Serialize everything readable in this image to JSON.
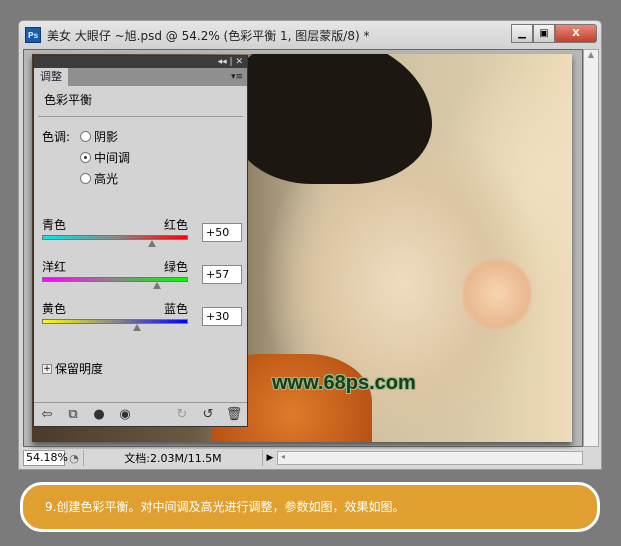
{
  "window": {
    "title": "美女 大眼仔 ~旭.psd @ 54.2% (色彩平衡 1, 图层蒙版/8) *",
    "app_icon": "Ps",
    "minimize": "▁",
    "maximize": "▣",
    "close": "X"
  },
  "canvas": {
    "watermark": "www.68ps.com"
  },
  "status": {
    "zoom": "54.18%",
    "doc_info": "文档:2.03M/11.5M",
    "arrow": "▶"
  },
  "panel": {
    "collapse": "◂◂ | ✕",
    "tab": "调整",
    "menu": "▾≡",
    "title": "色彩平衡",
    "tone_label": "色调:",
    "tones": [
      {
        "label": "阴影",
        "selected": false
      },
      {
        "label": "中间调",
        "selected": true
      },
      {
        "label": "高光",
        "selected": false
      }
    ],
    "sliders": [
      {
        "left": "青色",
        "right": "红色",
        "value": "+50",
        "num": 50,
        "colors": [
          "#00e8e8",
          "#ff0000"
        ]
      },
      {
        "left": "洋红",
        "right": "绿色",
        "value": "+57",
        "num": 57,
        "colors": [
          "#ff00ff",
          "#00ff00"
        ]
      },
      {
        "left": "黄色",
        "right": "蓝色",
        "value": "+30",
        "num": 30,
        "colors": [
          "#ffff00",
          "#0000ff"
        ]
      }
    ],
    "preserve": "保留明度",
    "footer_icons": [
      "back-arrow-icon",
      "clip-icon",
      "mask-icon",
      "eye-icon",
      "view-previous-icon",
      "reset-icon",
      "trash-icon"
    ]
  },
  "banner": {
    "text": "9.创建色彩平衡。对中间调及高光进行调整，参数如图，效果如图。",
    "color": "#e0a030"
  }
}
